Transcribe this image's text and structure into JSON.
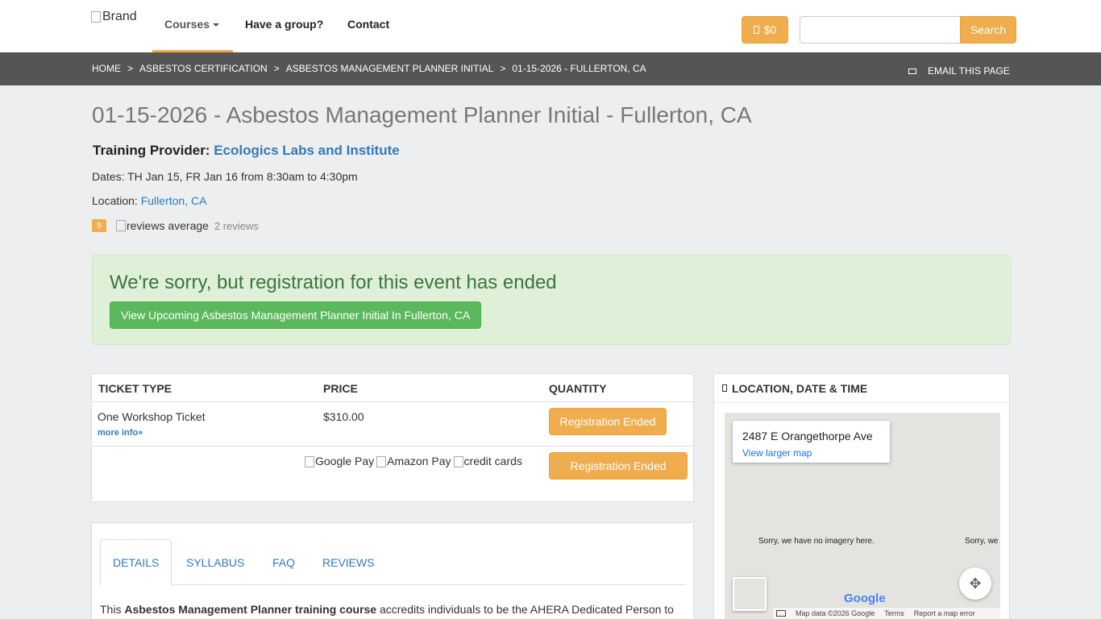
{
  "nav": {
    "brand": "Brand",
    "courses": "Courses",
    "group": "Have a group?",
    "contact": "Contact",
    "cart": "$0",
    "search_placeholder": "",
    "search_button": "Search"
  },
  "breadcrumb": {
    "items": [
      "HOME",
      "ASBESTOS CERTIFICATION",
      "ASBESTOS MANAGEMENT PLANNER INITIAL",
      "01-15-2026 - FULLERTON, CA"
    ],
    "separator": ">",
    "email": "EMAIL THIS PAGE"
  },
  "event": {
    "title": "01-15-2026 - Asbestos Management Planner Initial - Fullerton, CA",
    "provider_label": "Training Provider:",
    "provider_name": "Ecologics Labs and Institute",
    "dates": "Dates: TH Jan 15, FR Jan 16 from 8:30am to 4:30pm",
    "location_label": "Location:",
    "location_value": "Fullerton, CA",
    "rating": "5",
    "reviews_img_alt": "reviews average",
    "reviews_count": "2 reviews"
  },
  "alert": {
    "message": "We're sorry, but registration for this event has ended",
    "button": "View Upcoming Asbestos Management Planner Initial In Fullerton, CA"
  },
  "tickets": {
    "headers": [
      "TICKET TYPE",
      "PRICE",
      "QUANTITY"
    ],
    "row": {
      "type": "One Workshop Ticket",
      "more_info": "more info»",
      "price": "$310.00",
      "status": "Registration Ended"
    },
    "payments": [
      "Google Pay",
      "Amazon Pay",
      "credit cards"
    ],
    "main_button": "Registration Ended"
  },
  "details": {
    "tabs": [
      "DETAILS",
      "SYLLABUS",
      "FAQ",
      "REVIEWS"
    ],
    "text_prefix": "This ",
    "text_bold": "Asbestos Management Planner training course",
    "text_suffix": " accredits individuals to be the AHERA Dedicated Person to"
  },
  "location_panel": {
    "title": "LOCATION, DATE & TIME",
    "address": "2487 E Orangethorpe Ave",
    "view_larger": "View larger map",
    "no_imagery_1": "Sorry, we have no imagery here.",
    "no_imagery_2": "Sorry, we",
    "google": "Google",
    "footer": [
      "Map data ©2026 Google",
      "Terms",
      "Report a map error"
    ]
  },
  "colors": {
    "accent": "#f0ad4e",
    "link": "#337ab7",
    "success_bg": "#dff0d8",
    "success_btn": "#5cb85c",
    "breadcrumb_bg": "#555555"
  }
}
